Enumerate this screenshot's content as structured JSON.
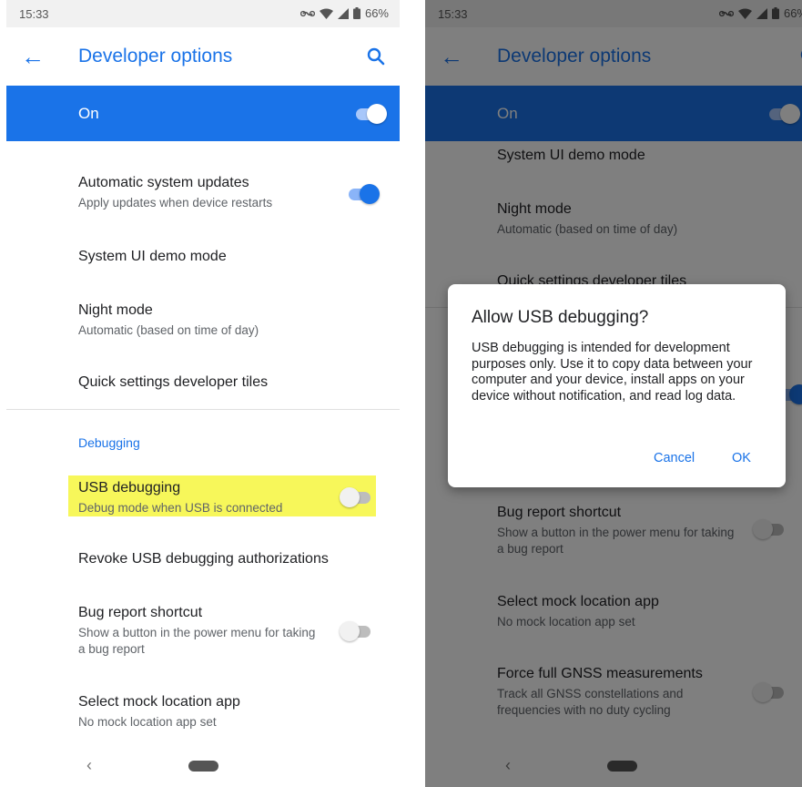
{
  "left": {
    "status": {
      "time": "15:33",
      "battery": "66%"
    },
    "app_bar": {
      "title": "Developer options"
    },
    "master": {
      "label": "On"
    },
    "rows": [
      {
        "title": "Automatic system updates",
        "subtitle": "Apply updates when device restarts"
      },
      {
        "title": "System UI demo mode"
      },
      {
        "title": "Night mode",
        "subtitle": "Automatic (based on time of day)"
      },
      {
        "title": "Quick settings developer tiles"
      }
    ],
    "section_header": "Debugging",
    "debug_rows": [
      {
        "title": "USB debugging",
        "subtitle": "Debug mode when USB is connected"
      },
      {
        "title": "Revoke USB debugging authorizations"
      },
      {
        "title": "Bug report shortcut",
        "subtitle": "Show a button in the power menu for taking a bug report"
      },
      {
        "title": "Select mock location app",
        "subtitle": "No mock location app set"
      }
    ]
  },
  "right": {
    "status": {
      "time": "15:33",
      "battery": "66%"
    },
    "app_bar": {
      "title": "Developer options"
    },
    "master": {
      "label": "On"
    },
    "rows": [
      {
        "title": "System UI demo mode"
      },
      {
        "title": "Night mode",
        "subtitle": "Automatic (based on time of day)"
      },
      {
        "title": "Quick settings developer tiles"
      },
      {
        "title": "Bug report shortcut",
        "subtitle": "Show a button in the power menu for taking a bug report"
      },
      {
        "title": "Select mock location app",
        "subtitle": "No mock location app set"
      },
      {
        "title": "Force full GNSS measurements",
        "subtitle": "Track all GNSS constellations and frequencies with no duty cycling"
      }
    ],
    "dialog": {
      "title": "Allow USB debugging?",
      "body": "USB debugging is intended for development purposes only. Use it to copy data between your computer and your device, install apps on your device without notification, and read log data.",
      "cancel": "Cancel",
      "ok": "OK"
    }
  },
  "colors": {
    "accent": "#1a73e8",
    "highlight": "#f7f75a",
    "status_bar": "#f1f1f1"
  },
  "icons": [
    "back-arrow-icon",
    "search-icon",
    "wifi-icon",
    "signal-icon",
    "battery-icon",
    "data-saver-icon",
    "nav-back-icon",
    "home-pill-icon"
  ]
}
